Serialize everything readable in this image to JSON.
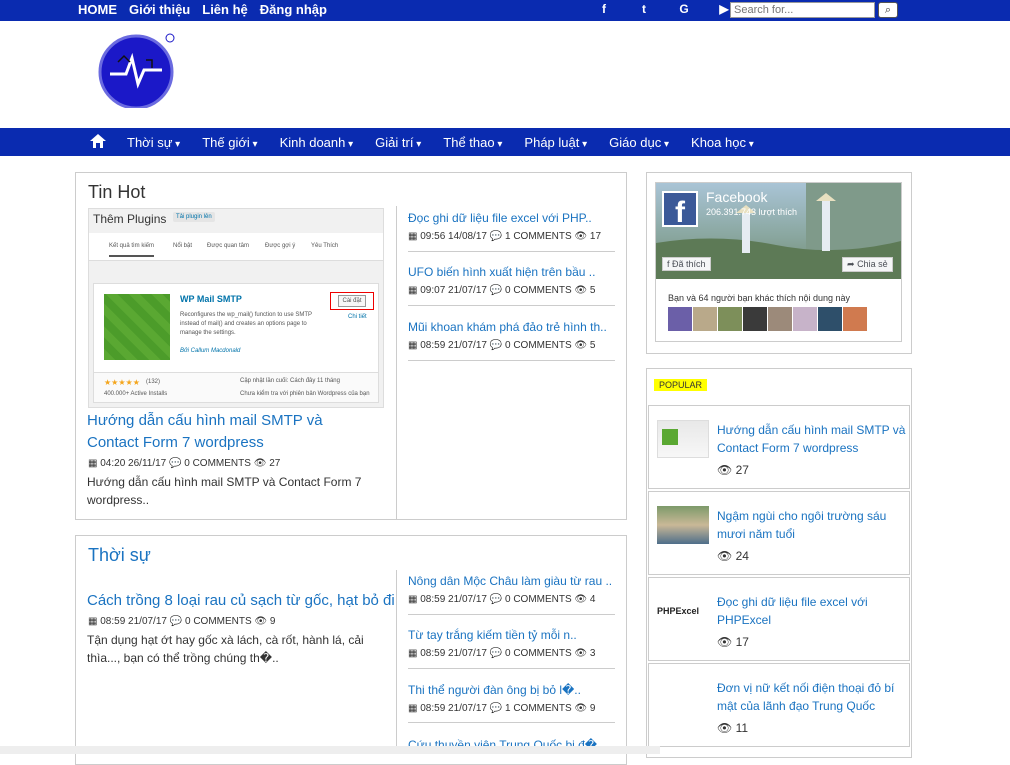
{
  "topbar": {
    "links": [
      "HOME",
      "Giới thiệu",
      "Liên hệ",
      "Đăng nhập"
    ],
    "social": [
      "f",
      "t",
      "G",
      "▶"
    ],
    "search_placeholder": "Search for..."
  },
  "nav": {
    "items": [
      "Thời sự",
      "Thế giới",
      "Kinh doanh",
      "Giải trí",
      "Thể thao",
      "Pháp luật",
      "Giáo dục",
      "Khoa học"
    ]
  },
  "tin_hot": {
    "title": "Tin Hot",
    "thumb": {
      "header": "Thêm Plugins",
      "upload": "Tải plugin lên",
      "tabs": [
        "Kết quả tìm kiếm",
        "Nổi bật",
        "Được quan tâm",
        "Được gợi ý",
        "Yêu Thích"
      ],
      "plugin_name": "WP Mail SMTP",
      "plugin_desc": "Reconfigures the wp_mail() function to use SMTP instead of mail() and creates an options page to manage the settings.",
      "author": "Bởi Callum Macdonald",
      "install": "Cài đặt",
      "details": "Chi tiết",
      "rating_count": "(132)",
      "installs": "400.000+ Active Installs",
      "updated": "Cập nhật lần cuối: Cách đây 11 tháng",
      "compat": "Chưa kiểm tra với phiên bản Wordpress của bạn"
    },
    "main": {
      "title": "Hướng dẫn cấu hình mail SMTP và Contact Form 7 wordpress",
      "meta": "04:20 26/11/17",
      "comments": "0 COMMENTS",
      "views": "27",
      "excerpt": "Hướng dẫn cấu hình mail SMTP và Contact Form 7 wordpress.."
    },
    "side": [
      {
        "title": "Đọc ghi dữ liệu file excel với PHP..",
        "time": "09:56 14/08/17",
        "comments": "1 COMMENTS",
        "views": "17"
      },
      {
        "title": "UFO biến hình xuất hiện trên bầu ..",
        "time": "09:07 21/07/17",
        "comments": "0 COMMENTS",
        "views": "5"
      },
      {
        "title": "Mũi khoan khám phá đảo trẻ hình th..",
        "time": "08:59 21/07/17",
        "comments": "0 COMMENTS",
        "views": "5"
      }
    ]
  },
  "thoi_su": {
    "title": "Thời sự",
    "main": {
      "title": "Cách trồng 8 loại rau củ sạch từ gốc, hạt bỏ đi",
      "meta": "08:59 21/07/17",
      "comments": "0 COMMENTS",
      "views": "9",
      "excerpt": "Tận dụng hạt ớt hay gốc xà lách, cà rốt, hành lá, cải thìa..., bạn có thể trồng chúng th�.."
    },
    "side": [
      {
        "title": "Nông dân Mộc Châu làm giàu từ rau ..",
        "time": "08:59 21/07/17",
        "comments": "0 COMMENTS",
        "views": "4"
      },
      {
        "title": "Từ tay trắng kiếm tiền tỷ mỗi n..",
        "time": "08:59 21/07/17",
        "comments": "0 COMMENTS",
        "views": "3"
      },
      {
        "title": "Thi thể người đàn ông bị bỏ l�..",
        "time": "08:59 21/07/17",
        "comments": "1 COMMENTS",
        "views": "9"
      },
      {
        "title": "Cứu thuyền viên Trung Quốc bị đ�..",
        "time": "",
        "comments": "",
        "views": ""
      }
    ]
  },
  "facebook": {
    "name": "Facebook",
    "likes": "206.391.743 lượt thích",
    "liked": "Đã thích",
    "share": "Chia sẻ",
    "friends": "Bạn và 64 người bạn khác thích nội dung này"
  },
  "popular": {
    "tag": "POPULAR",
    "items": [
      {
        "title": "Hướng dẫn cấu hình mail SMTP và Contact Form 7 wordpress",
        "views": "27"
      },
      {
        "title": "Ngậm ngùi cho ngôi trường sáu mươi năm tuổi",
        "views": "24"
      },
      {
        "title": "Đọc ghi dữ liệu file excel với PHPExcel",
        "views": "17",
        "thumb_text": "PHPExcel"
      },
      {
        "title": "Đơn vị nữ kết nối điện thoại đỏ bí mật của lãnh đạo Trung Quốc",
        "views": "11"
      }
    ]
  },
  "colors": {
    "brand_blue": "#0a2bb0",
    "link_blue": "#1a73c1",
    "popular_tag": "#ffff00"
  }
}
